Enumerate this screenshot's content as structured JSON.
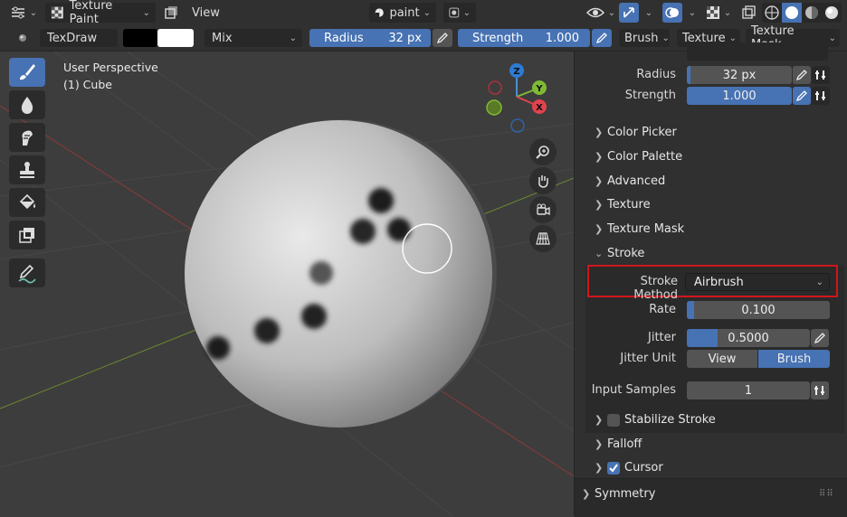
{
  "header": {
    "mode_label": "Texture Paint",
    "view_menu": "View",
    "texture_slot": "paint"
  },
  "toolbar": {
    "brush_name": "TexDraw",
    "blend_mode": "Mix",
    "radius_label": "Radius",
    "radius_value": "32 px",
    "strength_label": "Strength",
    "strength_value": "1.000",
    "brush_menu": "Brush",
    "texture_menu": "Texture",
    "texture_mask_menu": "Texture Mask"
  },
  "viewport": {
    "perspective": "User Perspective",
    "object": "(1) Cube",
    "gizmo": {
      "z": "Z",
      "y": "Y",
      "x": "X"
    }
  },
  "sidebar": {
    "radius_label": "Radius",
    "radius_value": "32 px",
    "strength_label": "Strength",
    "strength_value": "1.000",
    "panels": {
      "color_picker": "Color Picker",
      "color_palette": "Color Palette",
      "advanced": "Advanced",
      "texture": "Texture",
      "texture_mask": "Texture Mask",
      "stroke": "Stroke",
      "stabilize_stroke": "Stabilize Stroke",
      "falloff": "Falloff",
      "cursor": "Cursor",
      "symmetry": "Symmetry"
    },
    "stroke": {
      "method_label": "Stroke Method",
      "method_value": "Airbrush",
      "rate_label": "Rate",
      "rate_value": "0.100",
      "rate_fraction": 0.05,
      "jitter_label": "Jitter",
      "jitter_value": "0.5000",
      "jitter_fraction": 0.25,
      "jitter_unit_label": "Jitter Unit",
      "jitter_unit_options": [
        "View",
        "Brush"
      ],
      "jitter_unit_selected": "Brush",
      "input_samples_label": "Input Samples",
      "input_samples_value": "1"
    },
    "stabilize_checked": false,
    "cursor_checked": true
  },
  "colors": {
    "accent": "#4772b3",
    "highlight_box": "#d0161b",
    "header_bg": "#303030",
    "viewport_bg": "#3d3d3d"
  }
}
